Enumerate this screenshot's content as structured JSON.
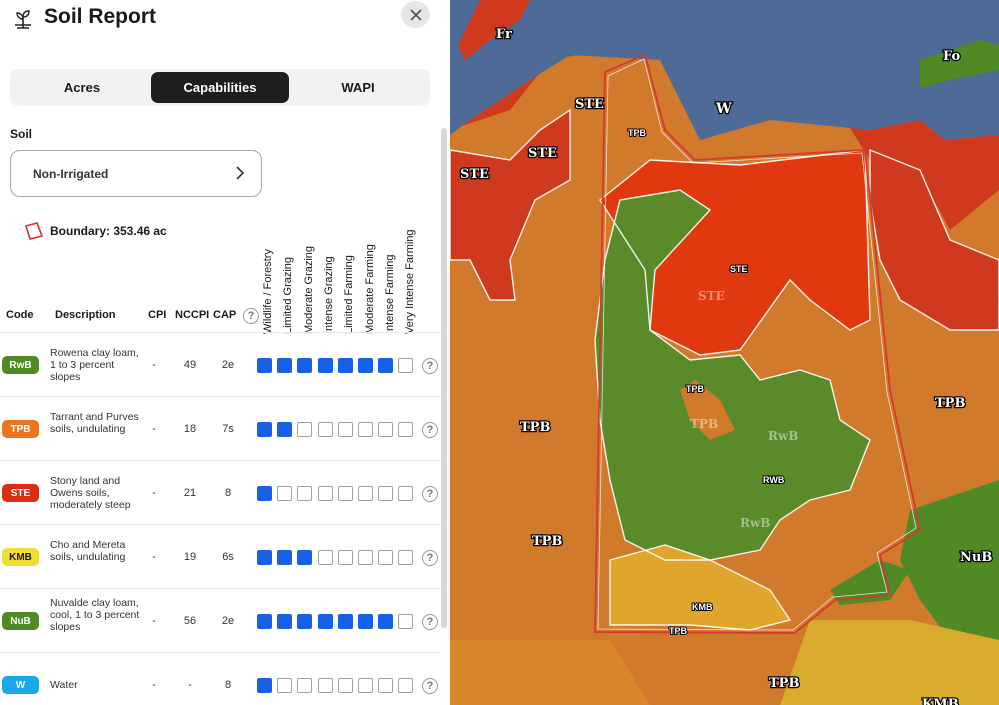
{
  "header": {
    "title": "Soil Report",
    "logo_icon": "sprout-icon",
    "close_icon": "close-icon"
  },
  "tabs": [
    {
      "label": "Acres",
      "active": false
    },
    {
      "label": "Capabilities",
      "active": true
    },
    {
      "label": "WAPI",
      "active": false
    }
  ],
  "soil": {
    "label": "Soil",
    "selected": "Non-Irrigated"
  },
  "boundary": {
    "label": "Boundary: 353.46 ac"
  },
  "table": {
    "headers": {
      "code": "Code",
      "description": "Description",
      "cpi": "CPI",
      "nccpi": "NCCPI",
      "cap": "CAP"
    },
    "capability_columns": [
      "Wildlife / Forestry",
      "Limited Grazing",
      "Moderate Grazing",
      "Intense Grazing",
      "Limited Farming",
      "Moderate Farming",
      "Intense Farming",
      "Very Intense Farming"
    ],
    "rows": [
      {
        "code": "RwB",
        "color": "#4f8a25",
        "text_color": "#ffffff",
        "description": "Rowena clay loam, 1 to 3 percent slopes",
        "cpi": "-",
        "nccpi": "49",
        "cap": "2e",
        "level": 7
      },
      {
        "code": "TPB",
        "color": "#e9761f",
        "text_color": "#ffffff",
        "description": "Tarrant and Purves soils, undulating",
        "cpi": "-",
        "nccpi": "18",
        "cap": "7s",
        "level": 2
      },
      {
        "code": "STE",
        "color": "#d92e10",
        "text_color": "#ffffff",
        "description": "Stony land and Owens soils, moderately steep",
        "cpi": "-",
        "nccpi": "21",
        "cap": "8",
        "level": 1
      },
      {
        "code": "KMB",
        "color": "#f2dc36",
        "text_color": "#1a1a1a",
        "description": "Cho and Mereta soils, undulating",
        "cpi": "-",
        "nccpi": "19",
        "cap": "6s",
        "level": 3
      },
      {
        "code": "NuB",
        "color": "#4f8a25",
        "text_color": "#ffffff",
        "description": "Nuvalde clay loam, cool, 1 to 3 percent slopes",
        "cpi": "-",
        "nccpi": "56",
        "cap": "2e",
        "level": 7
      },
      {
        "code": "W",
        "color": "#1aa7e6",
        "text_color": "#ffffff",
        "description": "Water",
        "cpi": "-",
        "nccpi": "-",
        "cap": "8",
        "level": 1
      }
    ]
  },
  "map": {
    "labels": [
      "Fr",
      "Fo",
      "W",
      "STE",
      "STE",
      "STE",
      "TPB",
      "STE",
      "STE",
      "TPB",
      "TPB",
      "RwB",
      "RWB",
      "RwB",
      "TPB",
      "TPB",
      "KMB",
      "TPB",
      "TPB",
      "NuB",
      "TPB",
      "KMB"
    ]
  }
}
